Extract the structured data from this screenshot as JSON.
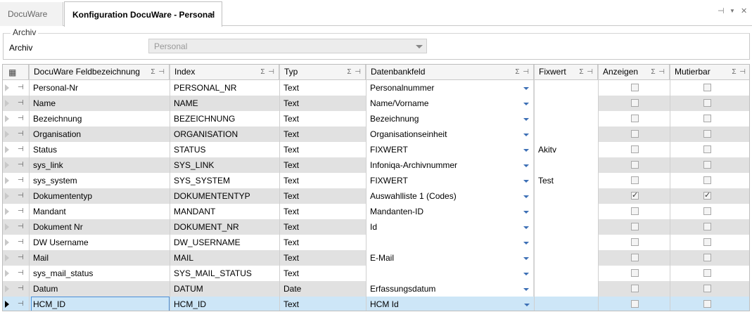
{
  "tabs": [
    {
      "label": "DocuWare"
    },
    {
      "label": "Konfiguration DocuWare - Personal",
      "close": "×"
    }
  ],
  "window_controls": {
    "pin": "⊣",
    "list": "▼",
    "close": "✕"
  },
  "archiv_group": {
    "legend": "Archiv",
    "label": "Archiv",
    "value": "Personal"
  },
  "grid": {
    "columns": [
      {
        "label": "DocuWare Feldbezeichnung",
        "icons": "Σ ⊣"
      },
      {
        "label": "Index",
        "icons": "Σ ⊣"
      },
      {
        "label": "Typ",
        "icons": "Σ ⊣"
      },
      {
        "label": "Datenbankfeld",
        "icons": "Σ ⊣"
      },
      {
        "label": "Fixwert",
        "icons": "Σ ⊣"
      },
      {
        "label": "Anzeigen",
        "icons": "Σ ⊣"
      },
      {
        "label": "Mutierbar",
        "icons": "Σ ⊣"
      }
    ],
    "rows": [
      {
        "name": "Personal-Nr",
        "index": "PERSONAL_NR",
        "typ": "Text",
        "db": "Personalnummer",
        "fix": "",
        "anzeigen": false,
        "mutierbar": false
      },
      {
        "name": "Name",
        "index": "NAME",
        "typ": "Text",
        "db": "Name/Vorname",
        "fix": "",
        "anzeigen": false,
        "mutierbar": false
      },
      {
        "name": "Bezeichnung",
        "index": "BEZEICHNUNG",
        "typ": "Text",
        "db": "Bezeichnung",
        "fix": "",
        "anzeigen": false,
        "mutierbar": false
      },
      {
        "name": "Organisation",
        "index": "ORGANISATION",
        "typ": "Text",
        "db": "Organisationseinheit",
        "fix": "",
        "anzeigen": false,
        "mutierbar": false
      },
      {
        "name": "Status",
        "index": "STATUS",
        "typ": "Text",
        "db": "FIXWERT",
        "fix": "Akitv",
        "anzeigen": false,
        "mutierbar": false
      },
      {
        "name": "sys_link",
        "index": "SYS_LINK",
        "typ": "Text",
        "db": "Infoniqa-Archivnummer",
        "fix": "",
        "anzeigen": false,
        "mutierbar": false
      },
      {
        "name": "sys_system",
        "index": "SYS_SYSTEM",
        "typ": "Text",
        "db": "FIXWERT",
        "fix": "Test",
        "anzeigen": false,
        "mutierbar": false
      },
      {
        "name": "Dokumententyp",
        "index": "DOKUMENTENTYP",
        "typ": "Text",
        "db": "Auswahlliste 1 (Codes)",
        "fix": "",
        "anzeigen": true,
        "mutierbar": true
      },
      {
        "name": "Mandant",
        "index": "MANDANT",
        "typ": "Text",
        "db": "Mandanten-ID",
        "fix": "",
        "anzeigen": false,
        "mutierbar": false
      },
      {
        "name": "Dokument Nr",
        "index": "DOKUMENT_NR",
        "typ": "Text",
        "db": "Id",
        "fix": "",
        "anzeigen": false,
        "mutierbar": false
      },
      {
        "name": "DW Username",
        "index": "DW_USERNAME",
        "typ": "Text",
        "db": "",
        "fix": "",
        "anzeigen": false,
        "mutierbar": false
      },
      {
        "name": "Mail",
        "index": "MAIL",
        "typ": "Text",
        "db": "E-Mail",
        "fix": "",
        "anzeigen": false,
        "mutierbar": false
      },
      {
        "name": "sys_mail_status",
        "index": "SYS_MAIL_STATUS",
        "typ": "Text",
        "db": "",
        "fix": "",
        "anzeigen": false,
        "mutierbar": false
      },
      {
        "name": "Datum",
        "index": "DATUM",
        "typ": "Date",
        "db": "Erfassungsdatum",
        "fix": "",
        "anzeigen": false,
        "mutierbar": false
      },
      {
        "name": "HCM_ID",
        "index": "HCM_ID",
        "typ": "Text",
        "db": "HCM Id",
        "fix": "",
        "anzeigen": false,
        "mutierbar": false,
        "selected": true
      }
    ]
  },
  "colors": {
    "selection": "#cde6f7",
    "alt_row": "#e1e1e1",
    "dropdown_arrow": "#3c6fb5"
  }
}
